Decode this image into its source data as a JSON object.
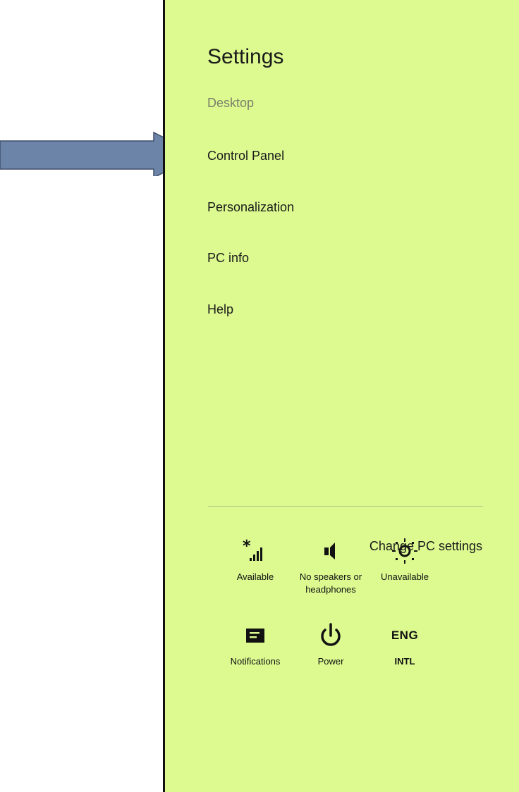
{
  "panel": {
    "title": "Settings",
    "items": [
      {
        "label": "Desktop"
      },
      {
        "label": "Control Panel"
      },
      {
        "label": "Personalization"
      },
      {
        "label": "PC info"
      },
      {
        "label": "Help"
      }
    ],
    "background_color": "#dcfa90"
  },
  "quick_settings": [
    {
      "icon": "network-signal-icon",
      "label": "Available"
    },
    {
      "icon": "volume-icon",
      "label": "No speakers or headphones"
    },
    {
      "icon": "brightness-icon",
      "label": "Unavailable"
    },
    {
      "icon": "notifications-icon",
      "label": "Notifications"
    },
    {
      "icon": "power-icon",
      "label": "Power"
    },
    {
      "icon_text": "ENG",
      "label": "INTL"
    }
  ],
  "footer": {
    "change_pc_settings": "Change PC settings"
  },
  "annotation": {
    "arrow_color": "#6b84a8"
  }
}
